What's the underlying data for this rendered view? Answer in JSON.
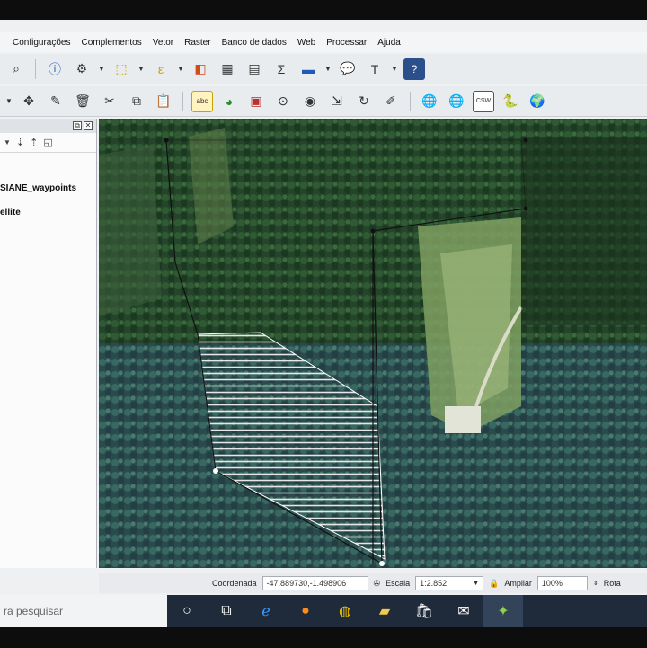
{
  "menu": [
    "Configurações",
    "Complementos",
    "Vetor",
    "Raster",
    "Banco de dados",
    "Web",
    "Processar",
    "Ajuda"
  ],
  "toolbar1": {
    "sum_label": "Σ",
    "text_label": "T",
    "help_label": "?"
  },
  "toolbar2": {
    "abc_label": "abc",
    "csw_label": "CSW"
  },
  "layers": {
    "items": [
      {
        "label": "SIANE_waypoints"
      },
      {
        "label": "ellite"
      }
    ]
  },
  "status": {
    "coord_label": "Coordenada",
    "coord_value": "-47.889730,-1.498906",
    "scale_label": "Escala",
    "scale_value": "1:2.852",
    "zoom_label": "Ampliar",
    "zoom_value": "100%",
    "rotation_label": "Rota"
  },
  "taskbar": {
    "search_placeholder": "ra pesquisar"
  },
  "colors": {
    "taskbar": "#1f2a3a",
    "forest_dark": "#1e3a22",
    "forest_mid": "#2f5a2c",
    "clearing": "#8fae6e"
  }
}
